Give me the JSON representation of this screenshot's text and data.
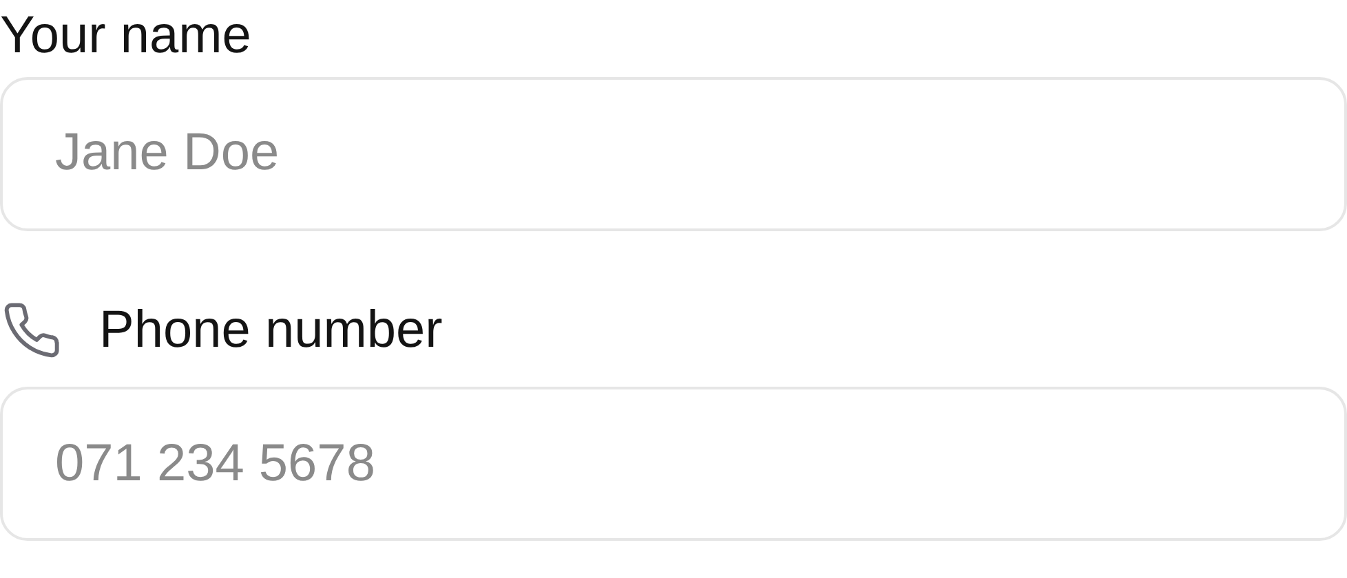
{
  "fields": [
    {
      "kind": "plain",
      "label": "Your name",
      "placeholder": "Jane Doe"
    },
    {
      "kind": "with-icon",
      "label": "Phone number",
      "placeholder": "071 234 5678"
    }
  ]
}
